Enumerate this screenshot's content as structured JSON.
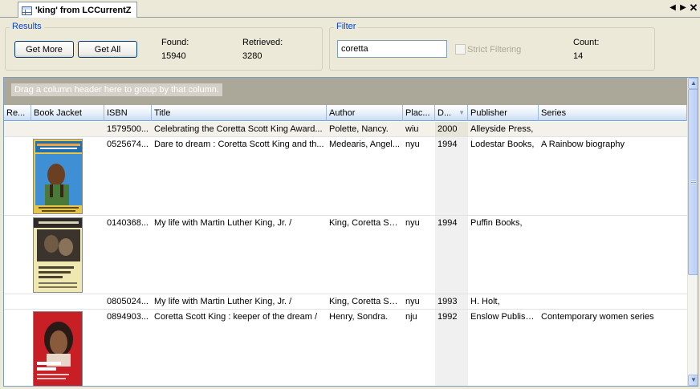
{
  "tab": {
    "title": "'king' from LCCurrentZ",
    "icon": "table-icon"
  },
  "results": {
    "title": "Results",
    "get_more": "Get More",
    "get_all": "Get All",
    "found_label": "Found:",
    "found_value": "15940",
    "retrieved_label": "Retrieved:",
    "retrieved_value": "3280"
  },
  "filter": {
    "title": "Filter",
    "value": "coretta",
    "strict_label": "Strict Filtering",
    "strict_checked": false,
    "count_label": "Count:",
    "count_value": "14"
  },
  "grid": {
    "group_hint": "Drag a column header here to group by that column.",
    "columns": [
      "Re...",
      "Book Jacket",
      "ISBN",
      "Title",
      "Author",
      "Plac...",
      "D...",
      "Publisher",
      "Series"
    ],
    "sorted_column": "D...",
    "rows": [
      {
        "isbn": "1579500...",
        "title": "Celebrating the Coretta Scott King Award...",
        "author": "Polette, Nancy.",
        "place": "wiu",
        "date": "2000",
        "publisher": "Alleyside Press,",
        "series": "",
        "jacket": "",
        "selected": true
      },
      {
        "isbn": "0525674...",
        "title": "Dare to dream : Coretta Scott King and th...",
        "author": "Medearis, Angel...",
        "place": "nyu",
        "date": "1994",
        "publisher": "Lodestar Books,",
        "series": "A Rainbow biography",
        "jacket": "dare-to-dream-cover"
      },
      {
        "isbn": "0140368...",
        "title": "My life with Martin Luther King, Jr. /",
        "author": "King, Coretta Sc...",
        "place": "nyu",
        "date": "1994",
        "publisher": "Puffin Books,",
        "series": "",
        "jacket": "my-life-cover"
      },
      {
        "isbn": "0805024...",
        "title": "My life with Martin Luther King, Jr. /",
        "author": "King, Coretta Sc...",
        "place": "nyu",
        "date": "1993",
        "publisher": "H. Holt,",
        "series": "",
        "jacket": ""
      },
      {
        "isbn": "0894903...",
        "title": "Coretta Scott King : keeper of the dream /",
        "author": "Henry, Sondra.",
        "place": "nju",
        "date": "1992",
        "publisher": "Enslow Publish...",
        "series": "Contemporary women series",
        "jacket": "keeper-of-dream-cover"
      }
    ]
  },
  "colors": {
    "accent": "#0046d5",
    "window_bg": "#ece9d8",
    "header_bottom": "#c9dcf2"
  }
}
